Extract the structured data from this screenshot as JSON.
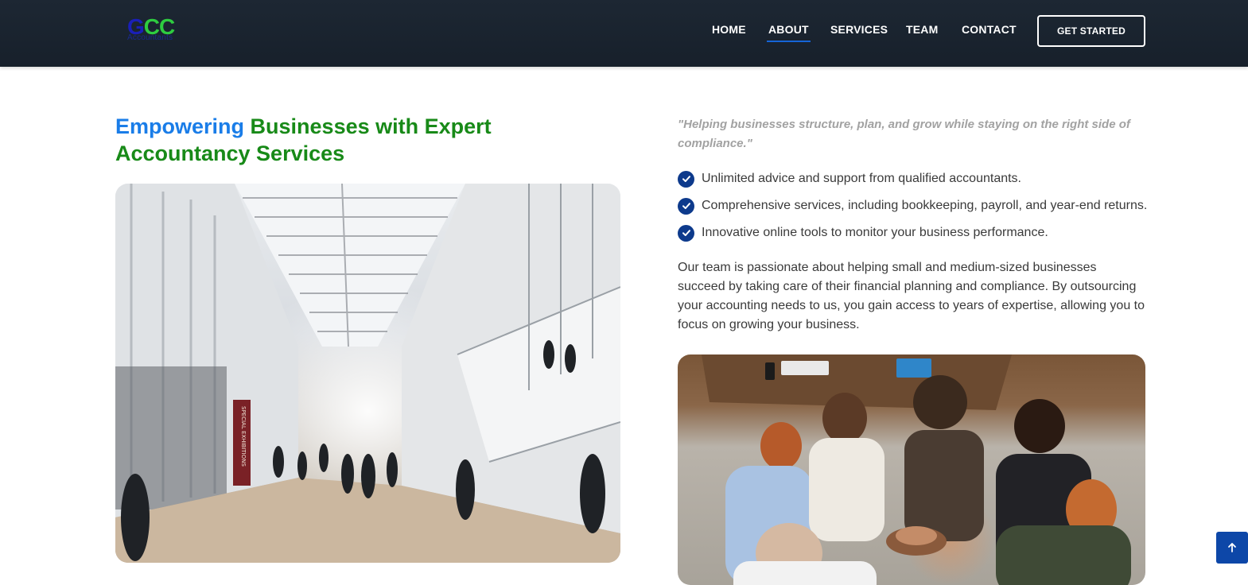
{
  "brand": {
    "logo_mark": "GCC",
    "logo_subtext": "Accountants",
    "colors": {
      "logo_blue": "#1a1fb8",
      "logo_green": "#2ecc40"
    }
  },
  "nav": {
    "items": [
      {
        "label": "HOME",
        "active": false
      },
      {
        "label": "ABOUT",
        "active": true
      },
      {
        "label": "SERVICES",
        "active": false
      },
      {
        "label": "TEAM",
        "active": false
      },
      {
        "label": "CONTACT",
        "active": false
      }
    ],
    "cta_label": "GET STARTED"
  },
  "about": {
    "headline_part1": "Empowering",
    "headline_part2": "Businesses with Expert Accountancy Services",
    "quote": "\"Helping businesses structure, plan, and grow while staying on the right side of compliance.\"",
    "checklist": [
      "Unlimited advice and support from qualified accountants.",
      "Comprehensive services, including bookkeeping, payroll, and year-end returns.",
      "Innovative online tools to monitor your business performance."
    ],
    "paragraph": "Our team is passionate about helping small and medium-sized businesses succeed by taking care of their financial planning and compliance. By outsourcing your accounting needs to us, you gain access to years of expertise, allowing you to focus on growing your business.",
    "hall_photo_sign": "SPECIAL EXHIBITIONS"
  },
  "colors": {
    "header_bg": "#1d2733",
    "accent_blue": "#1a7de8",
    "accent_green": "#188a18",
    "check_blue": "#0d3a8c",
    "scroll_button": "#0d47a8"
  },
  "icons": {
    "check": "check-circle-icon",
    "scroll_top": "arrow-up-icon"
  }
}
